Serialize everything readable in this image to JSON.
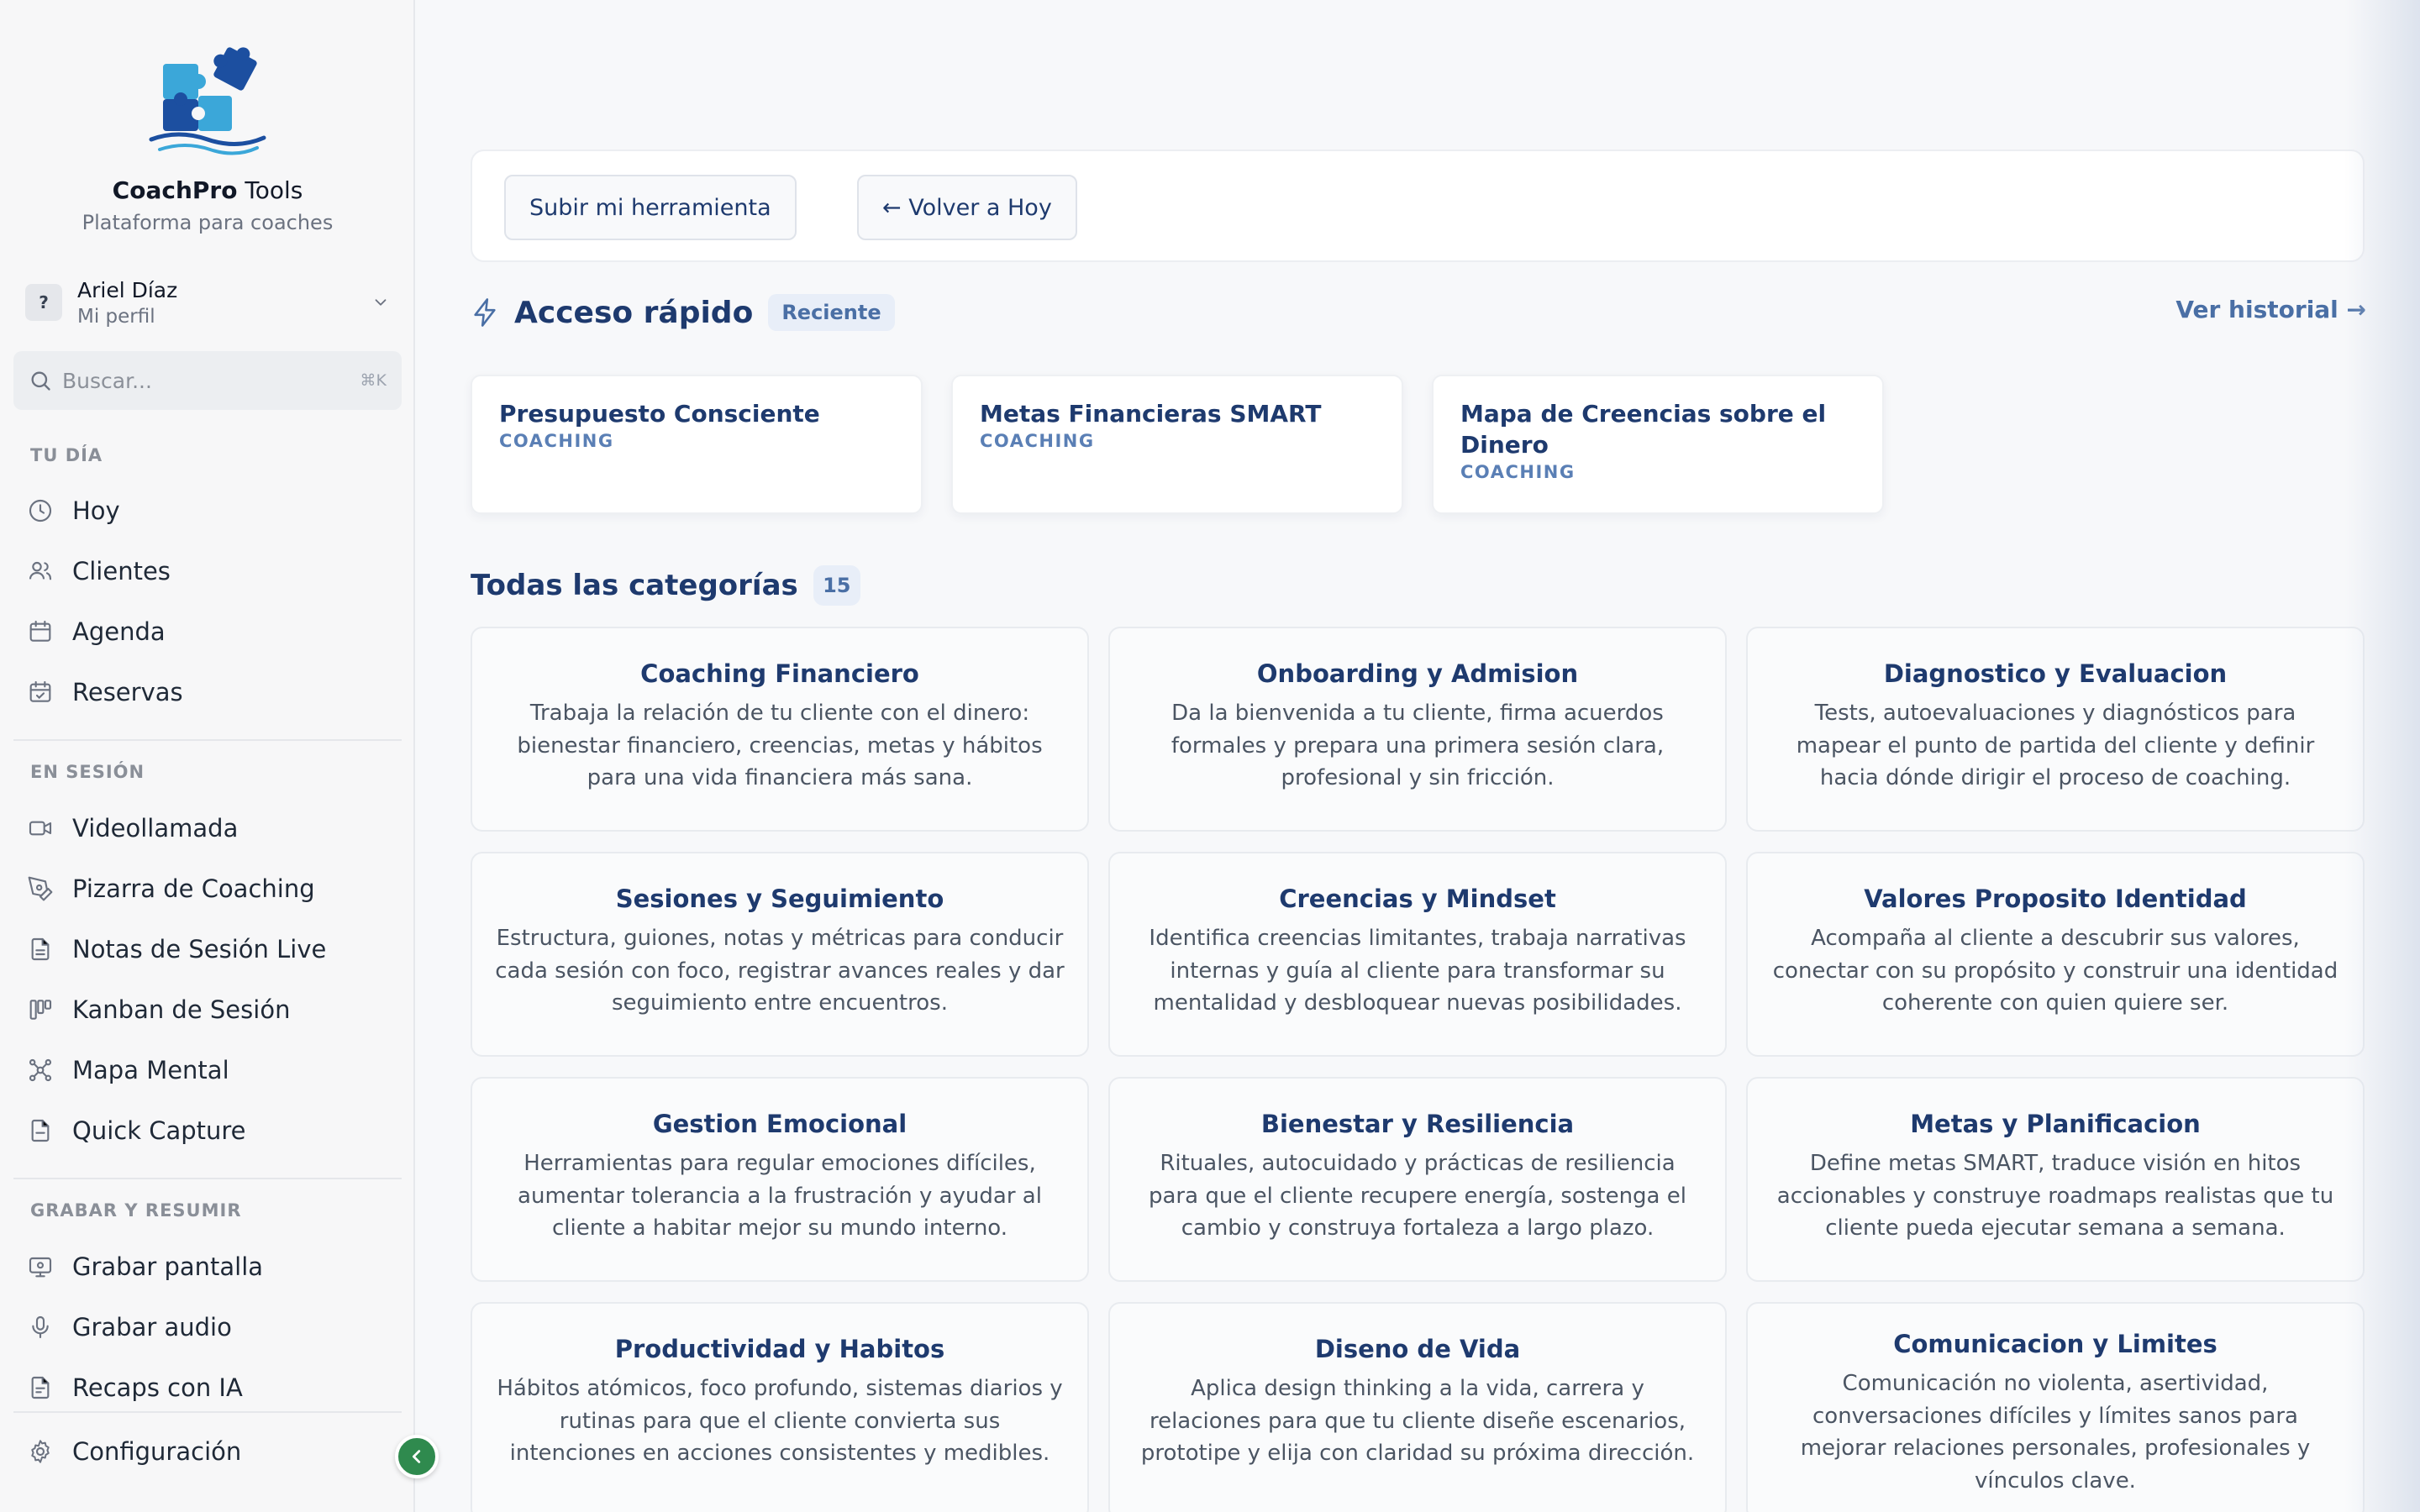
{
  "brand": {
    "name_bold": "CoachPro",
    "name_rest": " Tools",
    "subtitle": "Plataforma para coaches"
  },
  "profile": {
    "avatar": "?",
    "name": "Ariel Díaz",
    "role": "Mi perfil"
  },
  "search": {
    "placeholder": "Buscar...",
    "shortcut": "⌘K"
  },
  "sidebar": {
    "sections": [
      {
        "label": "TU DÍA",
        "items": [
          {
            "label": "Hoy",
            "icon": "clock-icon"
          },
          {
            "label": "Clientes",
            "icon": "users-icon"
          },
          {
            "label": "Agenda",
            "icon": "calendar-icon"
          },
          {
            "label": "Reservas",
            "icon": "calendar-check-icon"
          }
        ]
      },
      {
        "label": "EN SESIÓN",
        "items": [
          {
            "label": "Videollamada",
            "icon": "video-icon"
          },
          {
            "label": "Pizarra de Coaching",
            "icon": "pen-tool-icon"
          },
          {
            "label": "Notas de Sesión Live",
            "icon": "file-text-icon"
          },
          {
            "label": "Kanban de Sesión",
            "icon": "kanban-icon"
          },
          {
            "label": "Mapa Mental",
            "icon": "mind-map-icon"
          },
          {
            "label": "Quick Capture",
            "icon": "file-icon"
          }
        ]
      },
      {
        "label": "GRABAR Y RESUMIR",
        "items": [
          {
            "label": "Grabar pantalla",
            "icon": "screen-record-icon"
          },
          {
            "label": "Grabar audio",
            "icon": "microphone-icon"
          },
          {
            "label": "Recaps con IA",
            "icon": "file-ai-icon"
          }
        ]
      }
    ],
    "settings": {
      "label": "Configuración",
      "icon": "gear-icon"
    }
  },
  "toolbar": {
    "upload_label": "Subir mi herramienta",
    "back_label": "← Volver a Hoy"
  },
  "quick_access": {
    "title": "Acceso rápido",
    "badge": "Reciente",
    "history_link": "Ver historial →",
    "cards": [
      {
        "title": "Presupuesto Consciente",
        "tag": "COACHING"
      },
      {
        "title": "Metas Financieras SMART",
        "tag": "COACHING"
      },
      {
        "title": "Mapa de Creencias sobre el Dinero",
        "tag": "COACHING"
      }
    ]
  },
  "categories": {
    "title": "Todas las categorías",
    "count": "15",
    "items": [
      {
        "title": "Coaching Financiero",
        "desc": "Trabaja la relación de tu cliente con el dinero: bienestar financiero, creencias, metas y hábitos para una vida financiera más sana."
      },
      {
        "title": "Onboarding y Admision",
        "desc": "Da la bienvenida a tu cliente, firma acuerdos formales y prepara una primera sesión clara, profesional y sin fricción."
      },
      {
        "title": "Diagnostico y Evaluacion",
        "desc": "Tests, autoevaluaciones y diagnósticos para mapear el punto de partida del cliente y definir hacia dónde dirigir el proceso de coaching."
      },
      {
        "title": "Sesiones y Seguimiento",
        "desc": "Estructura, guiones, notas y métricas para conducir cada sesión con foco, registrar avances reales y dar seguimiento entre encuentros."
      },
      {
        "title": "Creencias y Mindset",
        "desc": "Identifica creencias limitantes, trabaja narrativas internas y guía al cliente para transformar su mentalidad y desbloquear nuevas posibilidades."
      },
      {
        "title": "Valores Proposito Identidad",
        "desc": "Acompaña al cliente a descubrir sus valores, conectar con su propósito y construir una identidad coherente con quien quiere ser."
      },
      {
        "title": "Gestion Emocional",
        "desc": "Herramientas para regular emociones difíciles, aumentar tolerancia a la frustración y ayudar al cliente a habitar mejor su mundo interno."
      },
      {
        "title": "Bienestar y Resiliencia",
        "desc": "Rituales, autocuidado y prácticas de resiliencia para que el cliente recupere energía, sostenga el cambio y construya fortaleza a largo plazo."
      },
      {
        "title": "Metas y Planificacion",
        "desc": "Define metas SMART, traduce visión en hitos accionables y construye roadmaps realistas que tu cliente pueda ejecutar semana a semana."
      },
      {
        "title": "Productividad y Habitos",
        "desc": "Hábitos atómicos, foco profundo, sistemas diarios y rutinas para que el cliente convierta sus intenciones en acciones consistentes y medibles."
      },
      {
        "title": "Diseno de Vida",
        "desc": "Aplica design thinking a la vida, carrera y relaciones para que tu cliente diseñe escenarios, prototipe y elija con claridad su próxima dirección."
      },
      {
        "title": "Comunicacion y Limites",
        "desc": "Comunicación no violenta, asertividad, conversaciones difíciles y límites sanos para mejorar relaciones personales, profesionales y vínculos clave."
      }
    ]
  },
  "colors": {
    "accent": "#1e3a6e",
    "accent_soft": "#4a6fa5",
    "collapse_button": "#2f8a4e"
  }
}
